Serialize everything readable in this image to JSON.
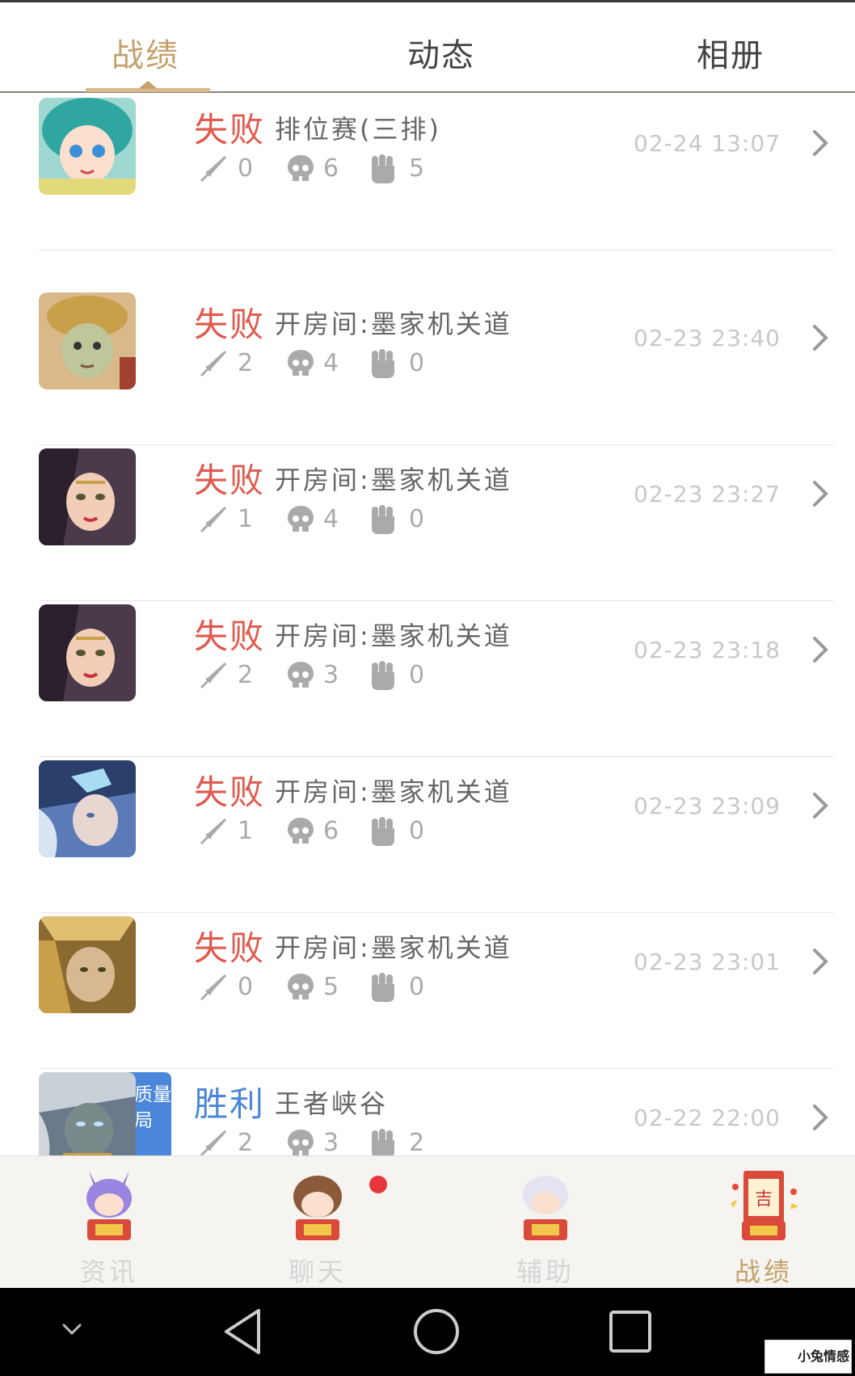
{
  "tabs": [
    {
      "label": "战绩",
      "active": true
    },
    {
      "label": "动态",
      "active": false
    },
    {
      "label": "相册",
      "active": false
    }
  ],
  "records": [
    {
      "result": "失败",
      "mode": "排位赛(三排)",
      "kills": "0",
      "deaths": "6",
      "assists": "5",
      "time": "02-24 13:07",
      "win": false
    },
    {
      "result": "失败",
      "mode": "开房间:墨家机关道",
      "kills": "2",
      "deaths": "4",
      "assists": "0",
      "time": "02-23 23:40",
      "win": false
    },
    {
      "result": "失败",
      "mode": "开房间:墨家机关道",
      "kills": "1",
      "deaths": "4",
      "assists": "0",
      "time": "02-23 23:27",
      "win": false
    },
    {
      "result": "失败",
      "mode": "开房间:墨家机关道",
      "kills": "2",
      "deaths": "3",
      "assists": "0",
      "time": "02-23 23:18",
      "win": false
    },
    {
      "result": "失败",
      "mode": "开房间:墨家机关道",
      "kills": "1",
      "deaths": "6",
      "assists": "0",
      "time": "02-23 23:09",
      "win": false
    },
    {
      "result": "失败",
      "mode": "开房间:墨家机关道",
      "kills": "0",
      "deaths": "5",
      "assists": "0",
      "time": "02-23 23:01",
      "win": false
    },
    {
      "result": "胜利",
      "mode": "王者峡谷",
      "kills": "2",
      "deaths": "3",
      "assists": "2",
      "time": "02-22 22:00",
      "win": true,
      "badge": "质量局"
    }
  ],
  "bottom_nav": [
    {
      "label": "资讯",
      "active": false
    },
    {
      "label": "聊天",
      "active": false,
      "has_dot": true
    },
    {
      "label": "辅助",
      "active": false
    },
    {
      "label": "战绩",
      "active": true
    }
  ],
  "watermark": "小兔情感",
  "colors": {
    "accent_gold": "#c4a06a",
    "loss_red": "#e05a4e",
    "win_blue": "#4a86d9",
    "notification_red": "#e8363c"
  }
}
